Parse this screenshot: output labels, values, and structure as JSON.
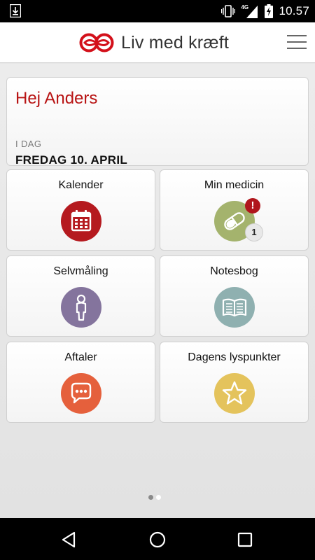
{
  "status_bar": {
    "time": "10.57",
    "network": "4G",
    "icons": [
      "download-icon",
      "vibrate-icon",
      "signal-icon",
      "battery-charging-icon"
    ]
  },
  "header": {
    "title": "Liv med kræft",
    "logo_icon": "infinity-logo-icon",
    "menu_icon": "hamburger-menu-icon"
  },
  "greeting": {
    "title": "Hej Anders",
    "today_label": "I DAG",
    "date": "FREDAG 10. APRIL"
  },
  "tiles": [
    {
      "label": "Kalender",
      "icon": "calendar-icon",
      "color": "#b51a1f"
    },
    {
      "label": "Min medicin",
      "icon": "pill-icon",
      "color": "#a4b36d",
      "alert": "!",
      "count": "1"
    },
    {
      "label": "Selvmåling",
      "icon": "person-icon",
      "color": "#84749d"
    },
    {
      "label": "Notesbog",
      "icon": "book-icon",
      "color": "#8fb0b0"
    },
    {
      "label": "Aftaler",
      "icon": "chat-bubble-icon",
      "color": "#e5603c"
    },
    {
      "label": "Dagens lyspunkter",
      "icon": "star-icon",
      "color": "#e4c35c"
    }
  ],
  "pager": {
    "pages": 2,
    "active": 0
  },
  "colors": {
    "brand_red": "#b81414",
    "dot_active": "#8a8a8a",
    "dot_inactive": "#ffffff"
  },
  "nav": {
    "icons": [
      "back-icon",
      "home-icon",
      "recents-icon"
    ]
  }
}
